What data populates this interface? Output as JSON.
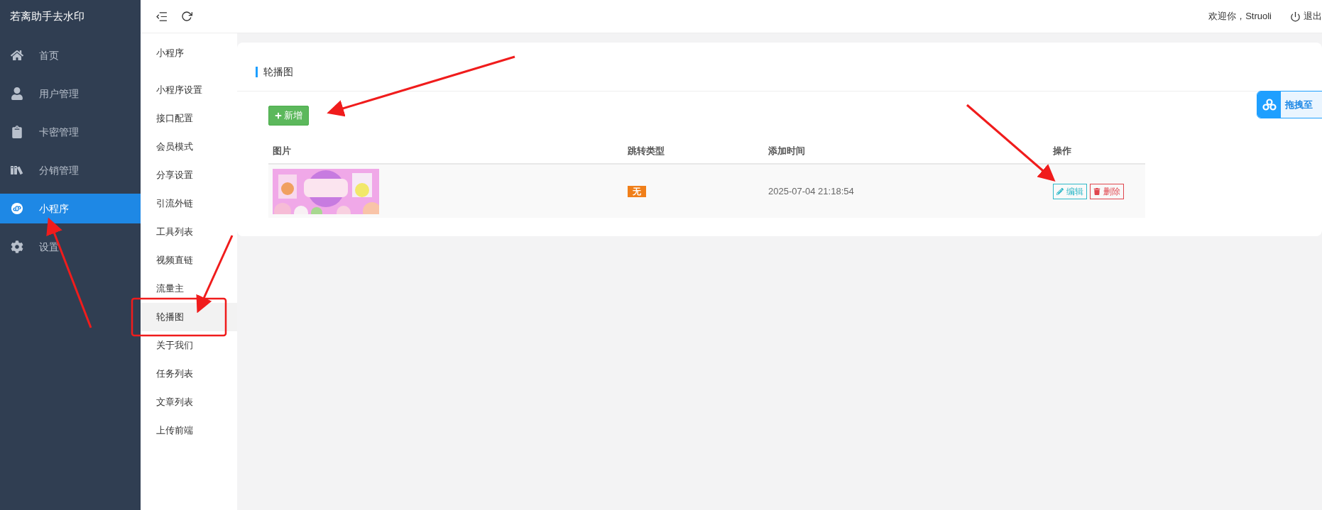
{
  "sidebar": {
    "title": "若离助手去水印",
    "items": [
      {
        "label": "首页",
        "selected": false
      },
      {
        "label": "用户管理",
        "selected": false
      },
      {
        "label": "卡密管理",
        "selected": false
      },
      {
        "label": "分销管理",
        "selected": false
      },
      {
        "label": "小程序",
        "selected": true
      },
      {
        "label": "设置",
        "selected": false
      }
    ]
  },
  "topbar": {
    "welcome": "欢迎你，Struoli",
    "logout": "退出"
  },
  "submenu": {
    "title": "小程序",
    "items": [
      {
        "label": "小程序设置",
        "selected": false
      },
      {
        "label": "接口配置",
        "selected": false
      },
      {
        "label": "会员模式",
        "selected": false
      },
      {
        "label": "分享设置",
        "selected": false
      },
      {
        "label": "引流外链",
        "selected": false
      },
      {
        "label": "工具列表",
        "selected": false
      },
      {
        "label": "视频直链",
        "selected": false
      },
      {
        "label": "流量主",
        "selected": false
      },
      {
        "label": "轮播图",
        "selected": true
      },
      {
        "label": "关于我们",
        "selected": false
      },
      {
        "label": "任务列表",
        "selected": false
      },
      {
        "label": "文章列表",
        "selected": false
      },
      {
        "label": "上传前端",
        "selected": false
      }
    ]
  },
  "card": {
    "title": "轮播图",
    "add_button": "新增",
    "table": {
      "columns": [
        "图片",
        "跳转类型",
        "添加时间",
        "操作"
      ],
      "rows": [
        {
          "jump_type": "无",
          "added": "2025-07-04 21:18:54",
          "actions": [
            {
              "kind": "edit",
              "label": "编辑"
            },
            {
              "kind": "delete",
              "label": "删除"
            }
          ]
        }
      ]
    }
  },
  "drop_widget": {
    "label": "拖拽至"
  }
}
